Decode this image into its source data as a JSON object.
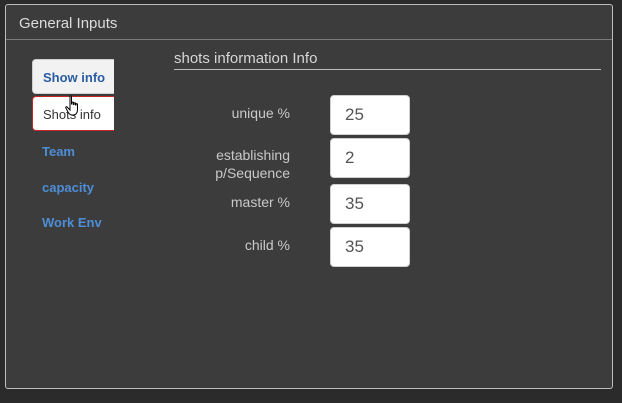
{
  "panel": {
    "title": "General Inputs"
  },
  "tabs": [
    {
      "label": "Show info"
    },
    {
      "label": "Shots info"
    },
    {
      "label": "Team"
    },
    {
      "label": "capacity"
    },
    {
      "label": "Work Env"
    }
  ],
  "section": {
    "title": "shots information Info"
  },
  "fields": [
    {
      "label": "unique %",
      "value": "25"
    },
    {
      "label": "establishing p/Sequence",
      "value": "2"
    },
    {
      "label": "master %",
      "value": "35"
    },
    {
      "label": "child %",
      "value": "35"
    }
  ],
  "colors": {
    "tab_link": "#4d8ed6",
    "hover_border": "#c62828",
    "panel_bg": "#3c3c3c"
  }
}
